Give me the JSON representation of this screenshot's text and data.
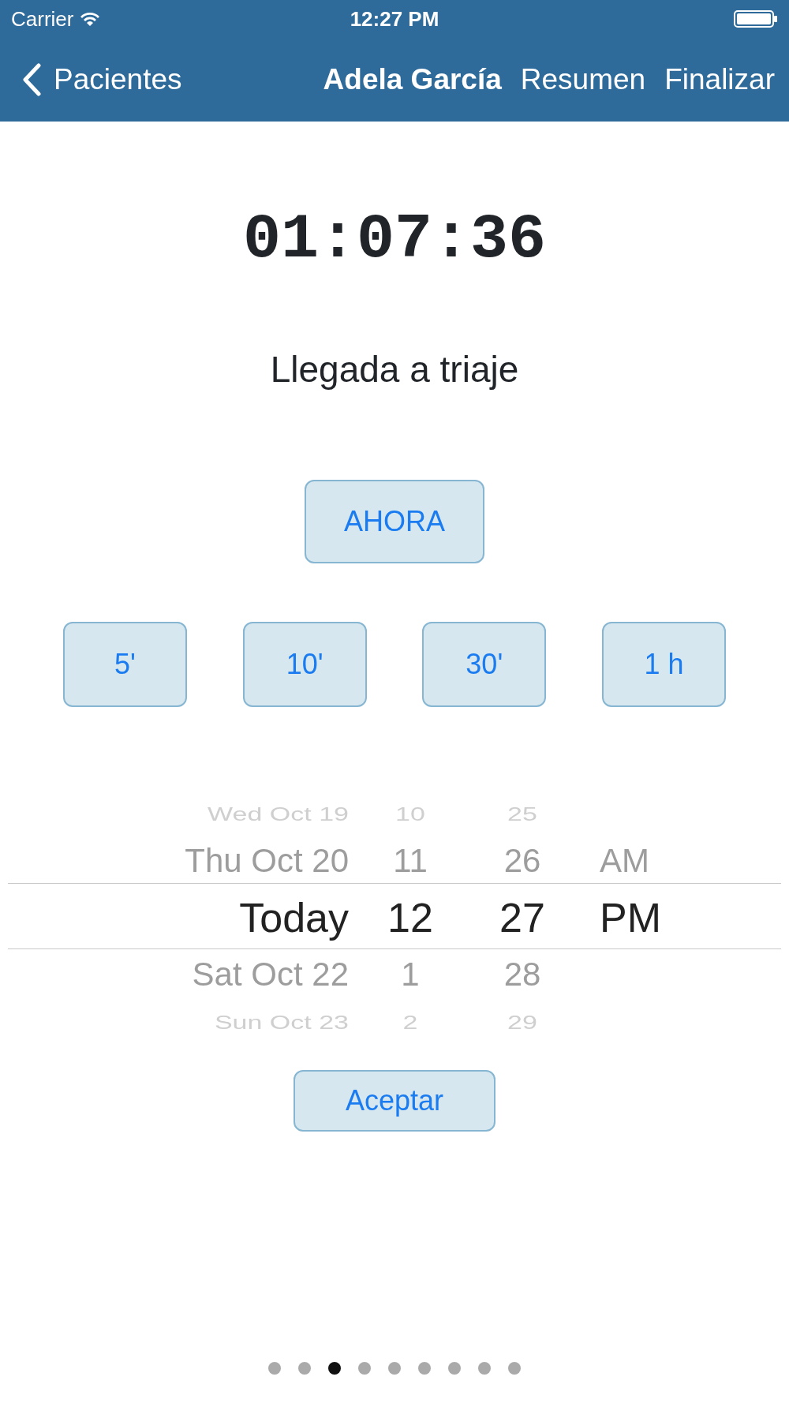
{
  "status_bar": {
    "carrier": "Carrier",
    "time": "12:27 PM"
  },
  "nav": {
    "back": "Pacientes",
    "title": "Adela García",
    "actions": [
      "Resumen",
      "Finalizar"
    ]
  },
  "timer": "01:07:36",
  "event": "Llegada a triaje",
  "now_button": "AHORA",
  "offset_buttons": [
    "5'",
    "10'",
    "30'",
    "1 h"
  ],
  "picker": {
    "columns": [
      {
        "kind": "date",
        "items": [
          {
            "label": "Wed Oct 19",
            "selected": false
          },
          {
            "label": "Thu Oct 20",
            "selected": false
          },
          {
            "label": "Today",
            "selected": true
          },
          {
            "label": "Sat Oct 22",
            "selected": false
          },
          {
            "label": "Sun Oct 23",
            "selected": false
          }
        ]
      },
      {
        "kind": "hour",
        "items": [
          {
            "label": "10",
            "selected": false
          },
          {
            "label": "11",
            "selected": false
          },
          {
            "label": "12",
            "selected": true
          },
          {
            "label": "1",
            "selected": false
          },
          {
            "label": "2",
            "selected": false
          }
        ]
      },
      {
        "kind": "minute",
        "items": [
          {
            "label": "25",
            "selected": false
          },
          {
            "label": "26",
            "selected": false
          },
          {
            "label": "27",
            "selected": true
          },
          {
            "label": "28",
            "selected": false
          },
          {
            "label": "29",
            "selected": false
          }
        ]
      },
      {
        "kind": "ampm",
        "items": [
          {
            "label": "AM",
            "selected": false
          },
          {
            "label": "PM",
            "selected": true
          }
        ]
      }
    ]
  },
  "accept_button": "Aceptar",
  "pages": [
    {
      "selected": false
    },
    {
      "selected": false
    },
    {
      "selected": true
    },
    {
      "selected": false
    },
    {
      "selected": false
    },
    {
      "selected": false
    },
    {
      "selected": false
    },
    {
      "selected": false
    },
    {
      "selected": false
    }
  ]
}
